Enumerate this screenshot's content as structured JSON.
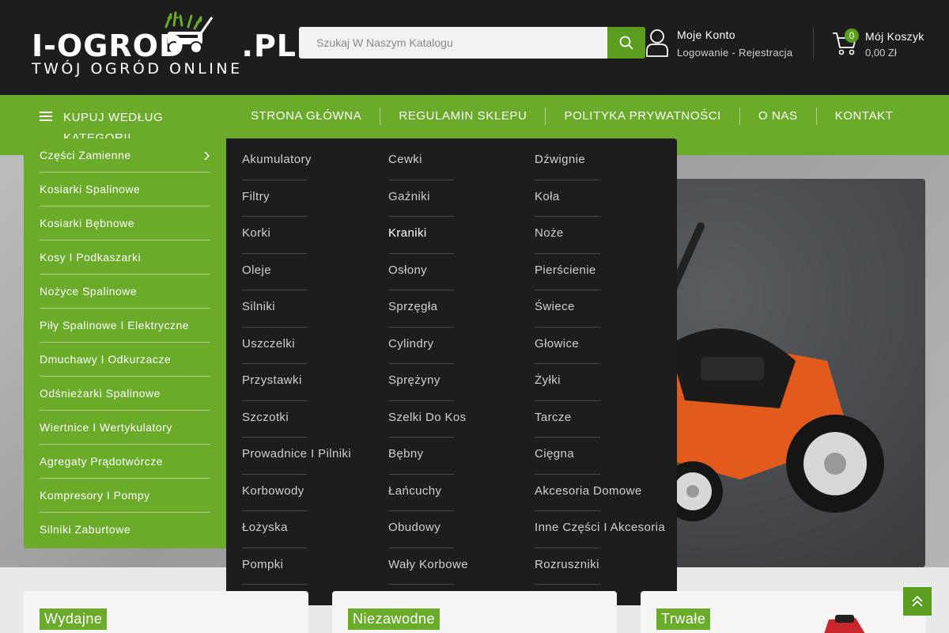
{
  "header": {
    "logo": {
      "main": "I-OGROD",
      "suffix": ".PL",
      "tagline": "TWÓJ OGRÓD ONLINE"
    },
    "search": {
      "placeholder": "Szukaj W Naszym Katalogu",
      "value": ""
    },
    "account": {
      "title": "Moje Konto",
      "subtitle": "Logowanie - Rejestracja"
    },
    "cart": {
      "count": "0",
      "title": "Mój Koszyk",
      "total": "0,00 Zł"
    }
  },
  "nav": {
    "categories_label": "KUPUJ WEDŁUG KATEGORII",
    "menu": [
      {
        "label": "STRONA GŁÓWNA"
      },
      {
        "label": "REGULAMIN SKLEPU"
      },
      {
        "label": "POLITYKA PRYWATNOŚCI"
      },
      {
        "label": "O NAS"
      },
      {
        "label": "KONTAKT"
      }
    ]
  },
  "sidebar": {
    "items": [
      {
        "label": "Części Zamienne"
      },
      {
        "label": "Kosiarki Spalinowe"
      },
      {
        "label": "Kosiarki Bębnowe"
      },
      {
        "label": "Kosy I Podkaszarki"
      },
      {
        "label": "Nożyce Spalinowe"
      },
      {
        "label": "Piły Spalinowe I Elektryczne"
      },
      {
        "label": "Dmuchawy I Odkurzacze"
      },
      {
        "label": "Odśnieżarki Spalinowe"
      },
      {
        "label": "Wiertnice I Wertykulatory"
      },
      {
        "label": "Agregaty Prądotwórcze"
      },
      {
        "label": "Kompresory I Pompy"
      },
      {
        "label": "Silniki Zaburtowe"
      }
    ]
  },
  "mega_menu": {
    "columns": [
      [
        "Akumulatory",
        "Filtry",
        "Korki",
        "Oleje",
        "Silniki",
        "Uszczelki",
        "Przystawki",
        "Szczotki",
        "Prowadnice I Pilniki",
        "Korbowody",
        "Łożyska",
        "Pompki"
      ],
      [
        "Cewki",
        "Gaźniki",
        "Kraniki",
        "Osłony",
        "Sprzęgła",
        "Cylindry",
        "Sprężyny",
        "Szelki Do Kos",
        "Bębny",
        "Łańcuchy",
        "Obudowy",
        "Wały Korbowe"
      ],
      [
        "Dźwignie",
        "Koła",
        "Noże",
        "Pierścienie",
        "Świece",
        "Głowice",
        "Żyłki",
        "Tarcze",
        "Cięgna",
        "Akcesoria Domowe",
        "Inne Części I Akcesoria",
        "Rozruszniki"
      ]
    ],
    "active_item": "Kraniki"
  },
  "cards": [
    {
      "label": "Wydajne"
    },
    {
      "label": "Niezawodne"
    },
    {
      "label": "Trwałe"
    }
  ],
  "colors": {
    "accent": "#6aab2a",
    "accent_dark": "#5a9d1f",
    "header_bg": "#1d1d1d"
  },
  "icons": {
    "search": "search-icon",
    "account": "user-icon",
    "cart": "cart-icon",
    "arrow": "chevron-right-icon",
    "back_to_top": "double-chevron-up-icon"
  }
}
